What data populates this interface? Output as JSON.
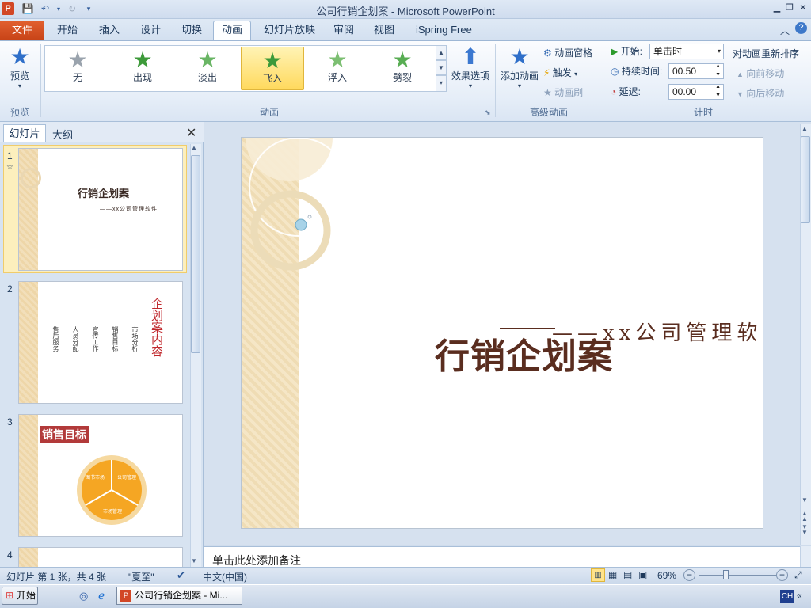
{
  "window": {
    "title": "公司行销企划案 - Microsoft PowerPoint",
    "app_icon": "P"
  },
  "colors": {
    "file_tab": "#d24726",
    "accent": "#2b5797",
    "slide_title": "#5a2d1f",
    "thumb_red": "#c0282d",
    "pie_orange": "#f5a623"
  },
  "tabs": [
    "文件",
    "开始",
    "插入",
    "设计",
    "切换",
    "动画",
    "幻灯片放映",
    "审阅",
    "视图",
    "iSpring Free"
  ],
  "active_tab": "动画",
  "ribbon": {
    "preview": {
      "label": "预览",
      "group": "预览"
    },
    "gallery": {
      "group": "动画",
      "items": [
        {
          "label": "无",
          "icon": "star-gray-icon"
        },
        {
          "label": "出现",
          "icon": "star-green-icon"
        },
        {
          "label": "淡出",
          "icon": "star-green-icon"
        },
        {
          "label": "飞入",
          "icon": "star-green-icon",
          "selected": true
        },
        {
          "label": "浮入",
          "icon": "star-green-icon"
        },
        {
          "label": "劈裂",
          "icon": "star-green-icon"
        }
      ]
    },
    "effect_options": "效果选项",
    "advanced": {
      "group": "高级动画",
      "add_animation": "添加动画",
      "animation_pane": "动画窗格",
      "trigger": "触发",
      "animation_painter": "动画刷"
    },
    "timing": {
      "group": "计时",
      "start_label": "开始:",
      "start_value": "单击时",
      "duration_label": "持续时间:",
      "duration_value": "00.50",
      "delay_label": "延迟:",
      "delay_value": "00.00",
      "reorder_title": "对动画重新排序",
      "move_earlier": "向前移动",
      "move_later": "向后移动"
    }
  },
  "left_pane": {
    "tab_slides": "幻灯片",
    "tab_outline": "大纲",
    "slides": [
      {
        "num": "1",
        "title": "行销企划案",
        "subtitle": "——xx公司管理软件"
      },
      {
        "num": "2",
        "title": "企划案内容",
        "items": [
          "市场分析",
          "销售目标",
          "宣传工作",
          "人员分配",
          "售后服务"
        ]
      },
      {
        "num": "3",
        "title": "销售目标",
        "segments": [
          "图书市场",
          "公司管理",
          "市场管理"
        ]
      },
      {
        "num": "4"
      }
    ]
  },
  "slide": {
    "title": "行销企划案",
    "subtitle": "——xx公司管理软件"
  },
  "notes_placeholder": "单击此处添加备注",
  "status": {
    "slide_info": "幻灯片 第 1 张，共 4 张",
    "theme": "\"夏至\"",
    "language": "中文(中国)",
    "zoom": "69%",
    "zoom_level": 0.69
  },
  "taskbar": {
    "start": "开始",
    "task": "公司行销企划案 - Mi...",
    "lang": "CH"
  }
}
